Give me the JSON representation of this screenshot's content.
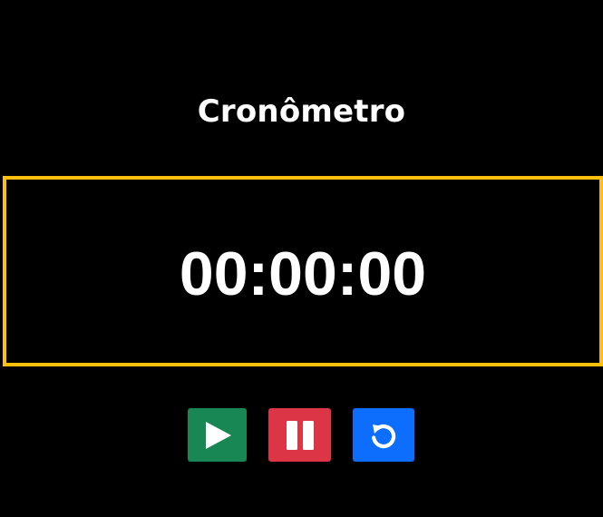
{
  "app": {
    "title": "Cronômetro"
  },
  "timer": {
    "display": "00:00:00"
  },
  "controls": [
    {
      "name": "start",
      "icon": "play-icon",
      "color": "#198754"
    },
    {
      "name": "pause",
      "icon": "pause-icon",
      "color": "#dc3545"
    },
    {
      "name": "reset",
      "icon": "reset-icon",
      "color": "#0d6efd"
    }
  ],
  "theme": {
    "background": "#000000",
    "text": "#ffffff",
    "display_border": "#ffbf0d"
  }
}
